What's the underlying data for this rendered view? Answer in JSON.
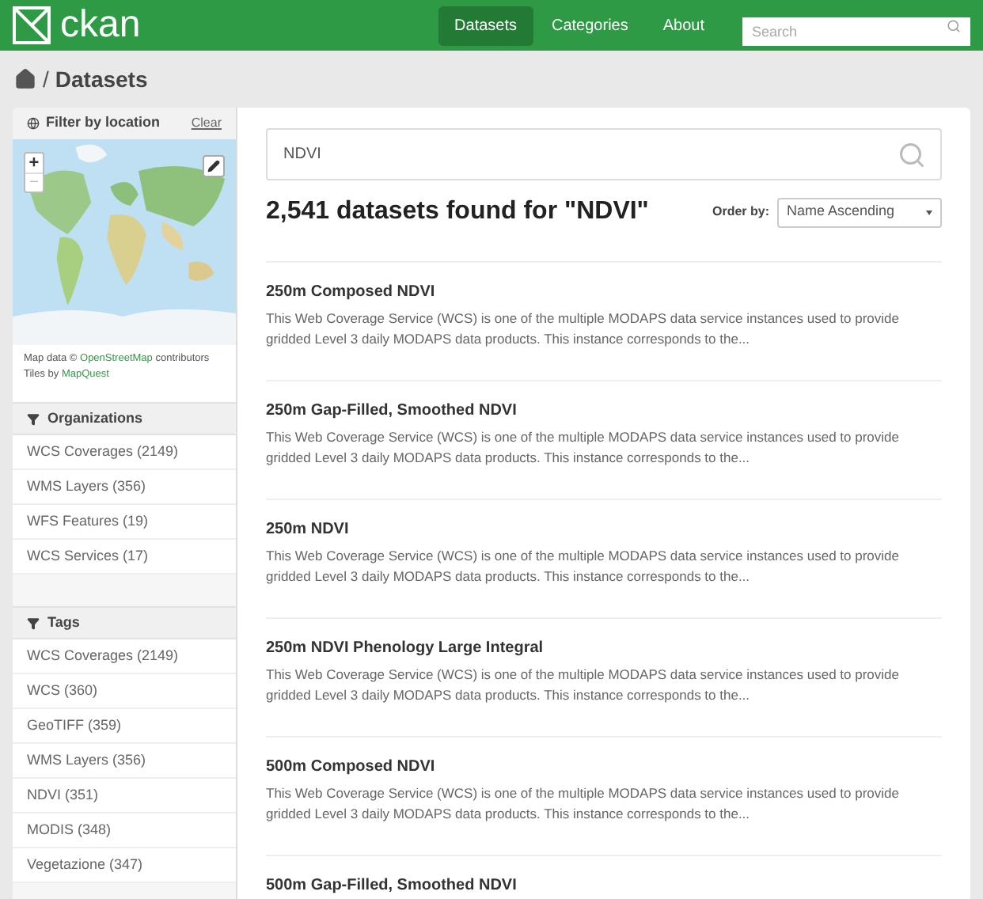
{
  "header": {
    "logo": "ckan",
    "nav": [
      {
        "label": "Datasets",
        "selected": true
      },
      {
        "label": "Categories",
        "selected": false
      },
      {
        "label": "About",
        "selected": false
      }
    ],
    "search": {
      "placeholder": "Search"
    }
  },
  "breadcrumb": {
    "separator": "/",
    "current": "Datasets"
  },
  "location_filter": {
    "title": "Filter by location",
    "clear": "Clear",
    "zoom_in": "+",
    "zoom_out": "−",
    "attribution": [
      {
        "text": "Map data ©",
        "link": "OpenStreetMap",
        "after": "contributors"
      },
      {
        "text": "Tiles by",
        "link": "MapQuest"
      }
    ]
  },
  "facets": [
    {
      "title": "Organizations",
      "items": [
        "WCS Coverages (2149)",
        "WMS Layers (356)",
        "WFS Features (19)",
        "WCS Services (17)"
      ]
    },
    {
      "title": "Tags",
      "items": [
        "WCS Coverages (2149)",
        "WCS (360)",
        "GeoTIFF (359)",
        "WMS Layers (356)",
        "NDVI (351)",
        "MODIS (348)",
        "Vegetazione (347)"
      ]
    }
  ],
  "search": {
    "value": "NDVI"
  },
  "results_heading": "2,541 datasets found for \"NDVI\"",
  "order_by": {
    "label": "Order by:",
    "value": "Name Ascending"
  },
  "datasets": [
    {
      "title": "250m Composed NDVI",
      "description": "This Web Coverage Service (WCS) is one of the multiple MODAPS data service instances used to provide gridded Level 3 daily MODAPS data products. This instance corresponds to the..."
    },
    {
      "title": "250m Gap-Filled, Smoothed NDVI",
      "description": "This Web Coverage Service (WCS) is one of the multiple MODAPS data service instances used to provide gridded Level 3 daily MODAPS data products. This instance corresponds to the..."
    },
    {
      "title": "250m NDVI",
      "description": "This Web Coverage Service (WCS) is one of the multiple MODAPS data service instances used to provide gridded Level 3 daily MODAPS data products. This instance corresponds to the..."
    },
    {
      "title": "250m NDVI Phenology Large Integral",
      "description": "This Web Coverage Service (WCS) is one of the multiple MODAPS data service instances used to provide gridded Level 3 daily MODAPS data products. This instance corresponds to the..."
    },
    {
      "title": "500m Composed NDVI",
      "description": "This Web Coverage Service (WCS) is one of the multiple MODAPS data service instances used to provide gridded Level 3 daily MODAPS data products. This instance corresponds to the..."
    },
    {
      "title": "500m Gap-Filled, Smoothed NDVI"
    }
  ]
}
